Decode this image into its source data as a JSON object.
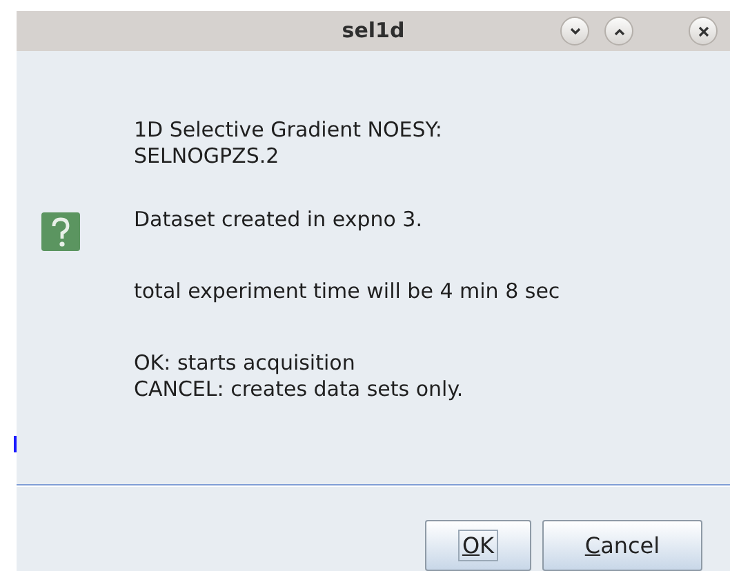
{
  "window": {
    "title": "sel1d"
  },
  "message": [
    [
      "1D Selective Gradient NOESY:",
      "SELNOGPZS.2"
    ],
    [
      "Dataset created in expno 3."
    ],
    [
      "total experiment time will be 4 min 8 sec"
    ],
    [
      "OK: starts acquisition",
      "CANCEL: creates data sets only."
    ]
  ],
  "buttons": [
    {
      "label": "OK",
      "first_letter_underlined": true,
      "focused": true
    },
    {
      "label": "Cancel",
      "first_letter_underlined": true,
      "focused": false
    }
  ]
}
